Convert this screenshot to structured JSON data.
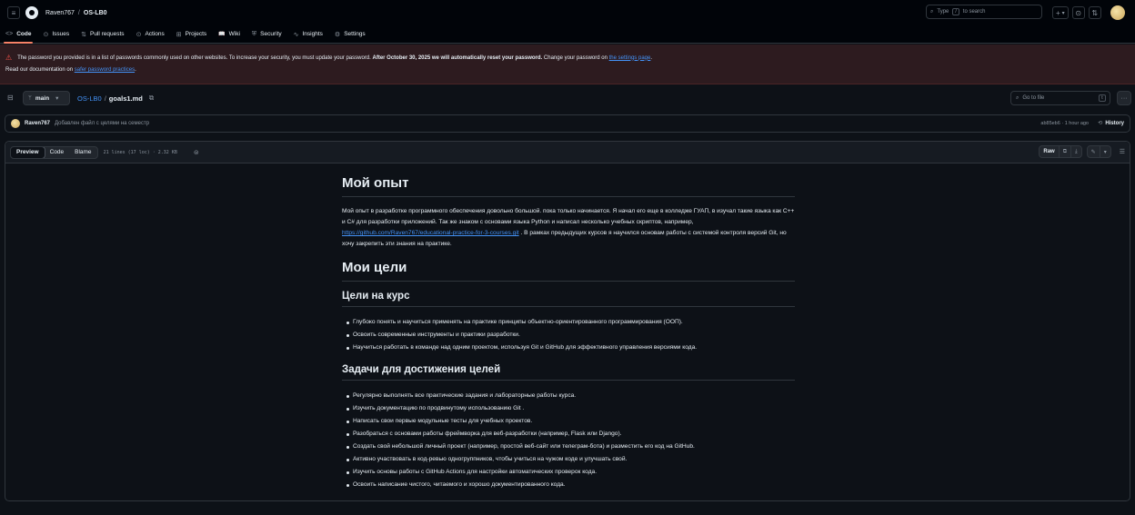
{
  "header": {
    "owner": "Raven767",
    "separator": "/",
    "repo": "OS-LB0",
    "search_prefix": "Type",
    "search_key": "/",
    "search_suffix": "to search",
    "plus_icon": "+",
    "caret": "▾",
    "issues_icon": "⊙",
    "pr_icon": "⇅"
  },
  "repo_nav": [
    {
      "label": "Code",
      "icon": "<>"
    },
    {
      "label": "Issues",
      "icon": "⊙"
    },
    {
      "label": "Pull requests",
      "icon": "⇅"
    },
    {
      "label": "Actions",
      "icon": "⊙"
    },
    {
      "label": "Projects",
      "icon": "⊞"
    },
    {
      "label": "Wiki",
      "icon": "📖"
    },
    {
      "label": "Security",
      "icon": "⛨"
    },
    {
      "label": "Insights",
      "icon": "∿"
    },
    {
      "label": "Settings",
      "icon": "⚙"
    }
  ],
  "banner": {
    "text1": "The password you provided is in a list of passwords commonly used on other websites. To increase your security, you must update your password.",
    "bold": "After October 30, 2025 we will automatically reset your password.",
    "text2": "Change your password on",
    "link1": "the settings page",
    "text3": ".",
    "line2_prefix": "Read our documentation on",
    "link2": "safer password practices",
    "line2_suffix": "."
  },
  "file_header": {
    "branch": "main",
    "repo_link": "OS-LB0",
    "separator": "/",
    "file_name": "goals1.md",
    "goto_placeholder": "Go to file",
    "goto_key": "t",
    "more": "···"
  },
  "commit": {
    "author": "Raven767",
    "message": "Добавлен файл с целями на семестр",
    "meta": "ab85eb6 · 1 hour ago",
    "history_label": "History"
  },
  "file_toolbar": {
    "tabs": [
      "Preview",
      "Code",
      "Blame"
    ],
    "info": "21 lines (17 loc) · 2.32 KB",
    "raw": "Raw"
  },
  "markdown": {
    "h1_experience": "Мой опыт",
    "p_part1": "Мой опыт в разработке программного обеспечения довольно большой. пока только начинается. Я начал его еще в колледже ГУАП, в изучал такие языка как C++ и C# для разработки приложений. Так же знаком с основами языка Python и написал несколько учебных скриптов, например,",
    "p_link": "https://github.com/Raven767/educational-practice-for-3-courses.git",
    "p_part2": ". В рамках предыдущих курсов я научился основам работы с системой контроля версий Git, но хочу закрепить эти знания на практике.",
    "h1_goals": "Мои цели",
    "h2_course": "Цели на курс",
    "course_goals": [
      "Глубоко понять и научиться применять на практике принципы объектно-ориентированного программирования (ООП).",
      "Освоить современные инструменты и практики разработки.",
      "Научиться работать в команде над одним проектом, используя Git и GitHub для эффективного управления версиями кода."
    ],
    "h2_tasks": "Задачи для достижения целей",
    "tasks": [
      "Регулярно выполнять все практические задания и лабораторные работы курса.",
      "Изучить документацию по продвинутому использованию Git .",
      "Написать свои первые модульные тесты для учебных проектов.",
      "Разобраться с основами работы фреймворка для веб-разработки (например, Flask или Django).",
      "Создать свой небольшой личный проект (например, простой веб-сайт или телеграм-бота) и разместить его код на GitHub.",
      "Активно участвовать в код-ревью одногруппников, чтобы учиться на чужом коде и улучшать свой.",
      "Изучить основы работы с GitHub Actions для настройки автоматических проверок кода.",
      "Освоить написание чистого, читаемого и хорошо документированного кода."
    ]
  }
}
